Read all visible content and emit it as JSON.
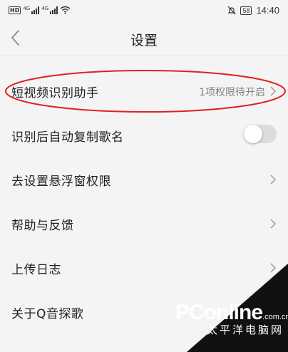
{
  "status_bar": {
    "hd_badge": "HD",
    "sim1_label": "4G",
    "sim2_label": "4G",
    "battery": "58",
    "time": "14:40"
  },
  "header": {
    "title": "设置",
    "back_icon": "chevron-left-icon"
  },
  "settings": [
    {
      "label": "短视频识别助手",
      "value": "1项权限待开启",
      "control": "chevron",
      "highlighted": true
    },
    {
      "label": "识别后自动复制歌名",
      "control": "toggle",
      "toggle_on": false
    },
    {
      "label": "去设置悬浮窗权限",
      "control": "chevron"
    },
    {
      "label": "帮助与反馈",
      "control": "chevron"
    },
    {
      "label": "上传日志",
      "control": "chevron"
    },
    {
      "label": "关于Q音探歌",
      "control": "none"
    }
  ],
  "watermark": {
    "logo": "PConline",
    "logo_suffix": ".com.cn",
    "chinese": "太平洋电脑网"
  },
  "colors": {
    "background": "#f4f4f4",
    "annotation": "#e02020",
    "secondary_text": "#808080",
    "toggle_off": "#dcdcdc"
  }
}
